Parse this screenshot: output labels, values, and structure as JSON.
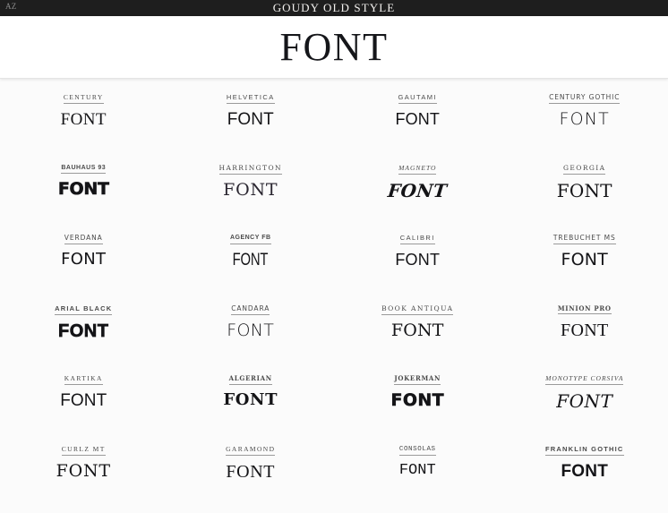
{
  "topbar": {
    "left_label": "AZ",
    "title": "GOUDY OLD STYLE",
    "background": "#1e1e1e",
    "text_color": "#f2f0ee"
  },
  "hero": {
    "word": "FONT",
    "background": "#ffffff"
  },
  "grid": {
    "columns": 4,
    "rows": 6,
    "sample_word": "FONT",
    "items": [
      {
        "label": "CENTURY",
        "sample": "FONT",
        "label_class": "lb-serif",
        "sample_class": "sp-century"
      },
      {
        "label": "HELVETICA",
        "sample": "FONT",
        "label_class": "lb-sans",
        "sample_class": "sp-helv"
      },
      {
        "label": "GAUTAMI",
        "sample": "FONT",
        "label_class": "lb-sans",
        "sample_class": "sp-gautami"
      },
      {
        "label": "CENTURY GOTHIC",
        "sample": "FONT",
        "label_class": "lb-dsans",
        "sample_class": "sp-geo"
      },
      {
        "label": "BAUHAUS 93",
        "sample": "FONT",
        "label_class": "lb-cond",
        "sample_class": "sp-bauhaus"
      },
      {
        "label": "HARRINGTON",
        "sample": "FONT",
        "label_class": "lb-dserif",
        "sample_class": "sp-harr"
      },
      {
        "label": "MAGNETO",
        "sample": "FONT",
        "label_class": "lb-ital",
        "sample_class": "sp-magneto"
      },
      {
        "label": "GEORGIA",
        "sample": "FONT",
        "label_class": "lb-dserif",
        "sample_class": "sp-georgia"
      },
      {
        "label": "VERDANA",
        "sample": "FONT",
        "label_class": "lb-dsans",
        "sample_class": "sp-verdana"
      },
      {
        "label": "AGENCY FB",
        "sample": "FONT",
        "label_class": "lb-cond",
        "sample_class": "sp-agency"
      },
      {
        "label": "CALIBRI",
        "sample": "FONT",
        "label_class": "lb-sans",
        "sample_class": "sp-calibri"
      },
      {
        "label": "TREBUCHET MS",
        "sample": "FONT",
        "label_class": "lb-dsans",
        "sample_class": "sp-trebuchet"
      },
      {
        "label": "ARIAL BLACK",
        "sample": "FONT",
        "label_class": "lb-bold",
        "sample_class": "sp-black"
      },
      {
        "label": "CANDARA",
        "sample": "FONT",
        "label_class": "lb-dsans",
        "sample_class": "sp-candara"
      },
      {
        "label": "BOOK ANTIQUA",
        "sample": "FONT",
        "label_class": "lb-dserif",
        "sample_class": "sp-bookant"
      },
      {
        "label": "MINION PRO",
        "sample": "FONT",
        "label_class": "lb-boldser",
        "sample_class": "sp-minion"
      },
      {
        "label": "KARTIKA",
        "sample": "FONT",
        "label_class": "lb-serif",
        "sample_class": "sp-kartika"
      },
      {
        "label": "ALGERIAN",
        "sample": "FONT",
        "label_class": "lb-boldser",
        "sample_class": "sp-algerian"
      },
      {
        "label": "JOKERMAN",
        "sample": "FONT",
        "label_class": "lb-boldser",
        "sample_class": "sp-jokerman"
      },
      {
        "label": "MONOTYPE CORSIVA",
        "sample": "FONT",
        "label_class": "lb-ital",
        "sample_class": "sp-corsiva"
      },
      {
        "label": "CURLZ MT",
        "sample": "FONT",
        "label_class": "lb-serif",
        "sample_class": "sp-curlz"
      },
      {
        "label": "GARAMOND",
        "sample": "FONT",
        "label_class": "lb-serif",
        "sample_class": "sp-garamond"
      },
      {
        "label": "CONSOLAS",
        "sample": "FONT",
        "label_class": "lb-mono",
        "sample_class": "sp-mono"
      },
      {
        "label": "FRANKLIN GOTHIC",
        "sample": "FONT",
        "label_class": "lb-bold",
        "sample_class": "sp-franklin"
      }
    ]
  }
}
